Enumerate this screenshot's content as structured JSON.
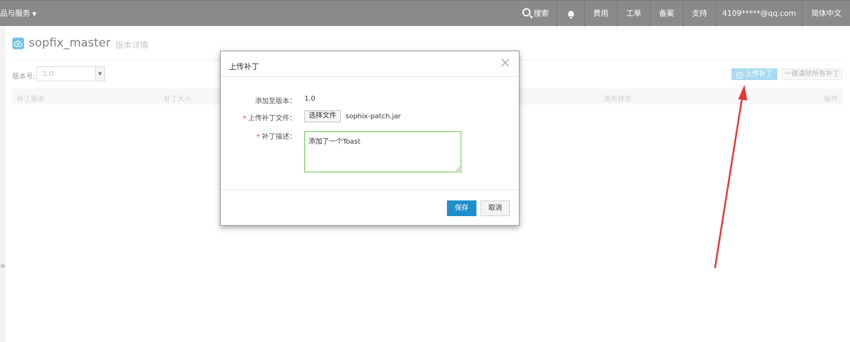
{
  "topbar": {
    "products_label": "品与服务",
    "search_label": "搜索",
    "billing_label": "费用",
    "tickets_label": "工单",
    "filing_label": "备案",
    "support_label": "支持",
    "account_label": "4109*****@qq.com",
    "language_label": "简体中文"
  },
  "page": {
    "title": "sopfix_master",
    "subtitle": "版本详情",
    "version_label": "版本号:",
    "version_value": "1.0",
    "upload_button": "上传补丁",
    "clear_button": "一键清除所有补丁"
  },
  "table": {
    "columns": [
      "补丁版本",
      "补丁大小",
      "发布状态",
      "操作"
    ]
  },
  "modal": {
    "title": "上传补丁",
    "add_to_version_label": "添加至版本：",
    "add_to_version_value": "1.0",
    "file_label": "上传补丁文件：",
    "choose_file_button": "选择文件",
    "file_name": "sophix-patch.jar",
    "desc_label": "补丁描述：",
    "desc_value": "添加了一个Toast",
    "required_mark": "*",
    "save_button": "保存",
    "cancel_button": "取消"
  },
  "colors": {
    "topbar": "#8a8a8a",
    "primary": "#1f8fcb",
    "upload_button": "#7dc7ea",
    "required": "#e63a3a",
    "annotation_arrow": "#e53535",
    "focus_border": "#63c34a"
  }
}
